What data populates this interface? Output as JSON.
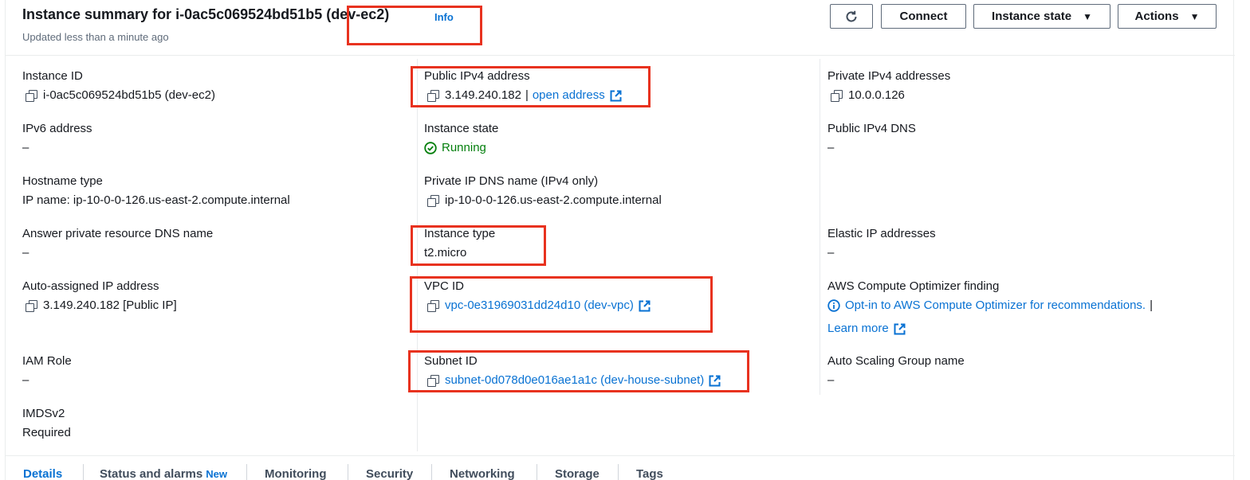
{
  "header": {
    "title": "Instance summary for i-0ac5c069524bd51b5 (dev-ec2)",
    "info": "Info",
    "updated": "Updated less than a minute ago",
    "buttons": {
      "connect": "Connect",
      "instance_state": "Instance state",
      "actions": "Actions"
    }
  },
  "fields": {
    "instance_id": {
      "label": "Instance ID",
      "value": "i-0ac5c069524bd51b5 (dev-ec2)"
    },
    "ipv6": {
      "label": "IPv6 address",
      "value": "–"
    },
    "hostname_type": {
      "label": "Hostname type",
      "value": "IP name: ip-10-0-0-126.us-east-2.compute.internal"
    },
    "answer_dns": {
      "label": "Answer private resource DNS name",
      "value": "–"
    },
    "auto_ip": {
      "label": "Auto-assigned IP address",
      "value": "3.149.240.182 [Public IP]"
    },
    "iam_role": {
      "label": "IAM Role",
      "value": "–"
    },
    "imdsv2": {
      "label": "IMDSv2",
      "value": "Required"
    },
    "public_ipv4": {
      "label": "Public IPv4 address",
      "value": "3.149.240.182",
      "separator": "|",
      "link": "open address"
    },
    "instance_state": {
      "label": "Instance state",
      "value": "Running"
    },
    "private_dns": {
      "label": "Private IP DNS name (IPv4 only)",
      "value": "ip-10-0-0-126.us-east-2.compute.internal"
    },
    "instance_type": {
      "label": "Instance type",
      "value": "t2.micro"
    },
    "vpc_id": {
      "label": "VPC ID",
      "value": "vpc-0e31969031dd24d10 (dev-vpc)"
    },
    "subnet_id": {
      "label": "Subnet ID",
      "value": "subnet-0d078d0e016ae1a1c (dev-house-subnet)"
    },
    "private_ipv4": {
      "label": "Private IPv4 addresses",
      "value": "10.0.0.126"
    },
    "public_dns": {
      "label": "Public IPv4 DNS",
      "value": "–"
    },
    "elastic_ip": {
      "label": "Elastic IP addresses",
      "value": "–"
    },
    "optimizer": {
      "label": "AWS Compute Optimizer finding",
      "link": "Opt-in to AWS Compute Optimizer for recommendations.",
      "separator": "|",
      "learn_more": "Learn more"
    },
    "asg": {
      "label": "Auto Scaling Group name",
      "value": "–"
    }
  },
  "tabs": [
    {
      "label": "Details",
      "active": true
    },
    {
      "label": "Status and alarms",
      "badge": "New"
    },
    {
      "label": "Monitoring"
    },
    {
      "label": "Security"
    },
    {
      "label": "Networking"
    },
    {
      "label": "Storage"
    },
    {
      "label": "Tags"
    }
  ],
  "colors": {
    "link": "#0972d3",
    "running": "#037f0c",
    "highlight": "#e8321f"
  },
  "icons": [
    "refresh-icon",
    "caret-down-icon",
    "copy-icon",
    "external-link-icon",
    "status-check-icon",
    "info-circle-icon"
  ]
}
